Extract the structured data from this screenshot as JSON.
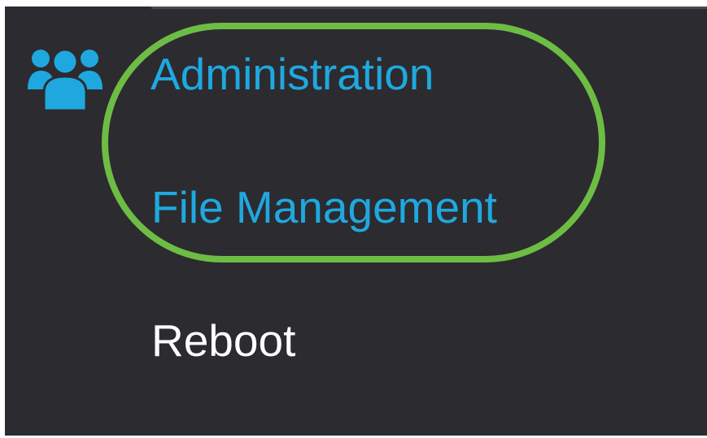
{
  "nav": {
    "section_icon": "users-group-icon",
    "items": [
      {
        "label": "Administration",
        "state": "active"
      },
      {
        "label": "File Management",
        "state": "active"
      },
      {
        "label": "Reboot",
        "state": "normal"
      }
    ]
  },
  "colors": {
    "panel_background": "#2c2b30",
    "active_link": "#1fa8df",
    "inactive_link": "#ffffff",
    "highlight_ring": "#6dbd44",
    "icon": "#1fa8df"
  }
}
